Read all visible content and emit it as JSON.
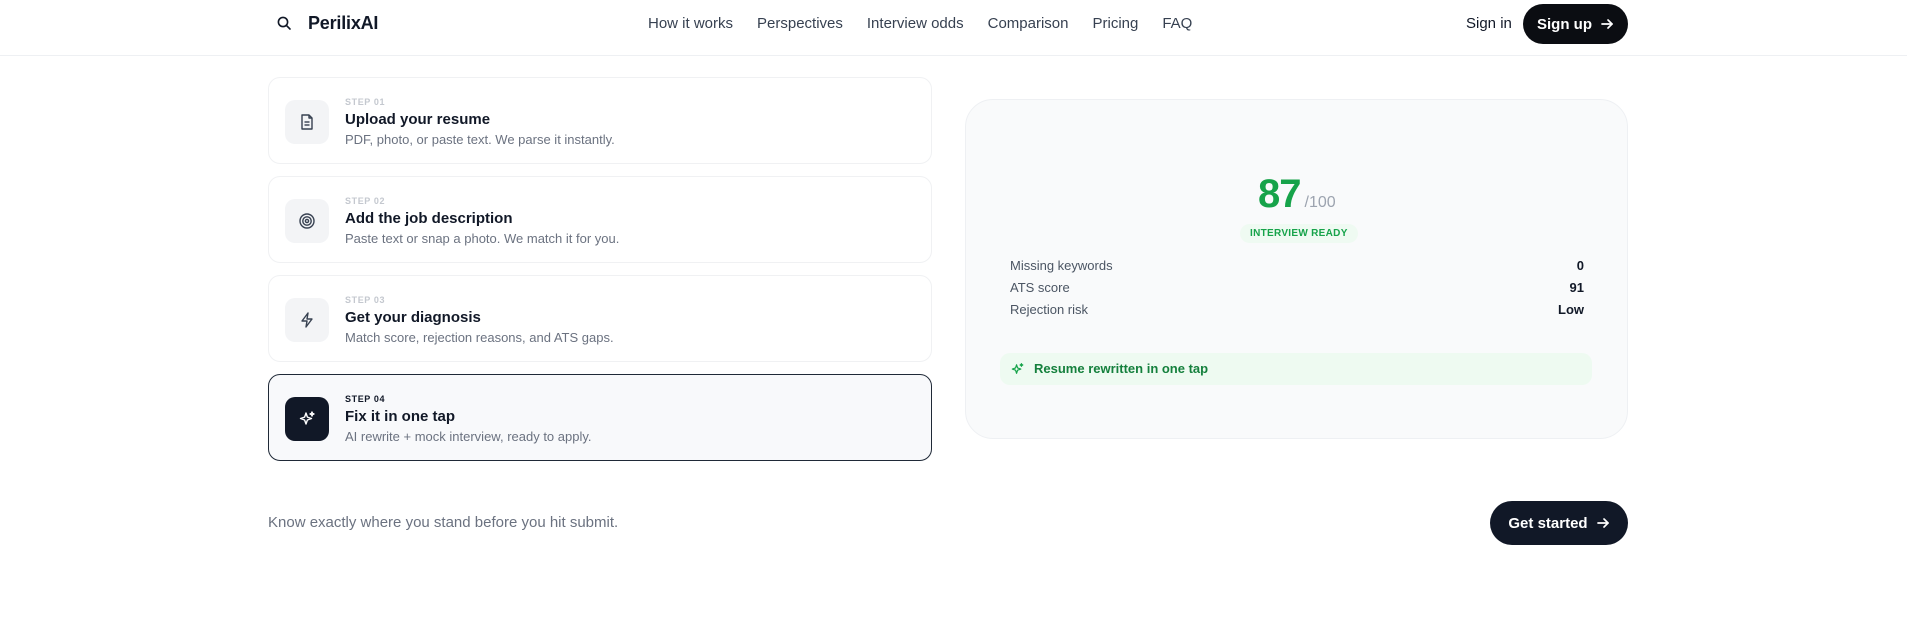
{
  "header": {
    "brand": "PerilixAI",
    "nav": [
      "How it works",
      "Perspectives",
      "Interview odds",
      "Comparison",
      "Pricing",
      "FAQ"
    ],
    "sign_in": "Sign in",
    "sign_up": "Sign up"
  },
  "steps": [
    {
      "number": "STEP 01",
      "title": "Upload your resume",
      "description": "PDF, photo, or paste text. We parse it instantly.",
      "icon": "document-icon",
      "active": false
    },
    {
      "number": "STEP 02",
      "title": "Add the job description",
      "description": "Paste text or snap a photo. We match it for you.",
      "icon": "target-icon",
      "active": false
    },
    {
      "number": "STEP 03",
      "title": "Get your diagnosis",
      "description": "Match score, rejection reasons, and ATS gaps.",
      "icon": "lightning-icon",
      "active": false
    },
    {
      "number": "STEP 04",
      "title": "Fix it in one tap",
      "description": "AI rewrite + mock interview, ready to apply.",
      "icon": "sparkles-icon",
      "active": true
    }
  ],
  "score_card": {
    "score": "87",
    "max": "/100",
    "status": "INTERVIEW READY",
    "metrics": [
      {
        "label": "Missing keywords",
        "value": "0"
      },
      {
        "label": "ATS score",
        "value": "91"
      },
      {
        "label": "Rejection risk",
        "value": "Low"
      }
    ],
    "rewrite_text": "Resume rewritten in one tap"
  },
  "footer": {
    "tagline": "Know exactly where you stand before you hit submit.",
    "cta": "Get started"
  },
  "colors": {
    "accent_green": "#16a34a",
    "dark": "#111827"
  }
}
